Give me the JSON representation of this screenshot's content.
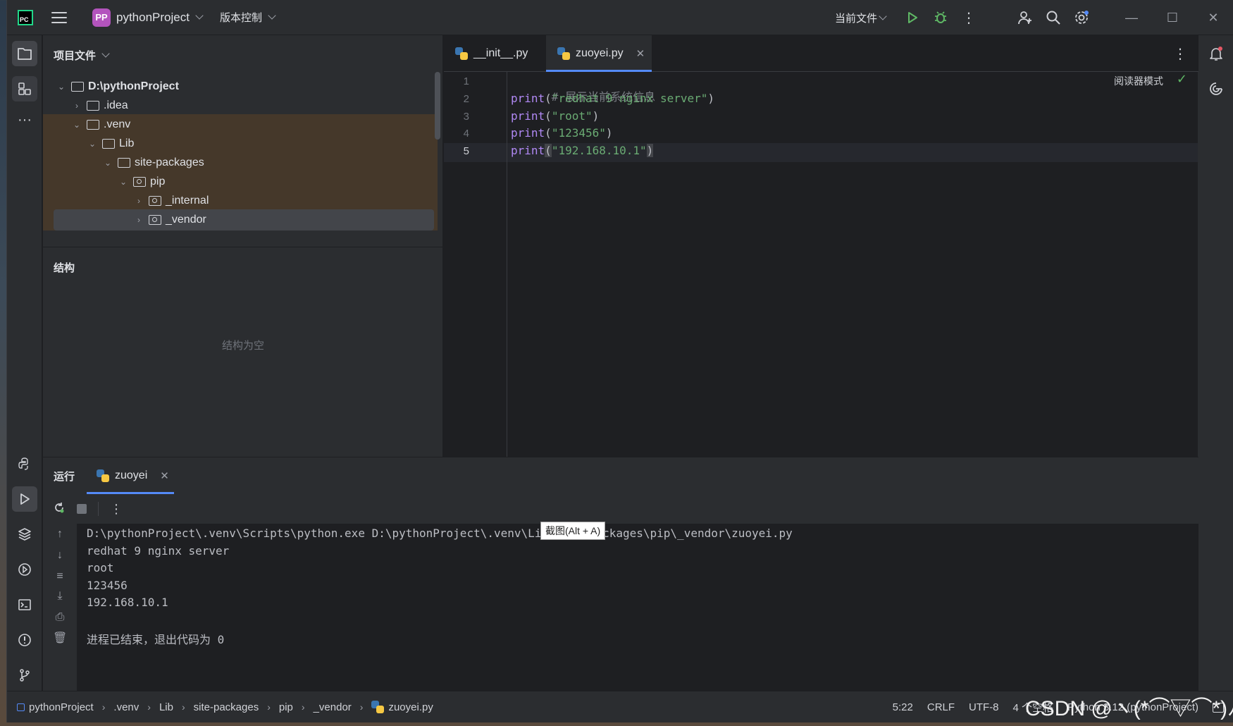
{
  "titlebar": {
    "logo_text": "PC",
    "project_badge": "PP",
    "project_name": "pythonProject",
    "vcs_label": "版本控制",
    "run_config_label": "当前文件"
  },
  "project_panel": {
    "title": "项目文件",
    "tree": [
      {
        "label": "D:\\pythonProject",
        "expanded": true,
        "bold": true
      },
      {
        "label": ".idea",
        "expanded": false
      },
      {
        "label": ".venv",
        "expanded": true
      },
      {
        "label": "Lib",
        "expanded": true
      },
      {
        "label": "site-packages",
        "expanded": true
      },
      {
        "label": "pip",
        "expanded": true
      },
      {
        "label": "_internal",
        "expanded": false
      },
      {
        "label": "_vendor",
        "expanded": false
      }
    ]
  },
  "structure_panel": {
    "title": "结构",
    "empty_text": "结构为空"
  },
  "editor": {
    "tabs": [
      {
        "label": "__init__.py",
        "active": false
      },
      {
        "label": "zuoyei.py",
        "active": true
      }
    ],
    "reader_mode": "阅读器模式",
    "lines": [
      {
        "num": "1",
        "comment": "# 展示当前系统信息"
      },
      {
        "num": "2",
        "fn": "print",
        "str": "\"redhat 9 nginx server\""
      },
      {
        "num": "3",
        "fn": "print",
        "str": "\"root\""
      },
      {
        "num": "4",
        "fn": "print",
        "str": "\"123456\""
      },
      {
        "num": "5",
        "fn": "print",
        "str": "\"192.168.10.1\""
      }
    ]
  },
  "run_panel": {
    "title": "运行",
    "tab_label": "zuoyei",
    "output": [
      "D:\\pythonProject\\.venv\\Scripts\\python.exe D:\\pythonProject\\.venv\\Lib\\site-packages\\pip\\_vendor\\zuoyei.py",
      "redhat 9 nginx server",
      "root",
      "123456",
      "192.168.10.1",
      "",
      "进程已结束，退出代码为 0"
    ],
    "tooltip": "截图(Alt + A)"
  },
  "statusbar": {
    "breadcrumbs": [
      "pythonProject",
      ".venv",
      "Lib",
      "site-packages",
      "pip",
      "_vendor",
      "zuoyei.py"
    ],
    "position": "5:22",
    "line_ending": "CRLF",
    "encoding": "UTF-8",
    "indent": "4 个空格",
    "interpreter": "Python 3.12 (pythonProject)"
  },
  "watermark": "CSDN @ヽ(*⌒▽⌒*)ﾉ"
}
